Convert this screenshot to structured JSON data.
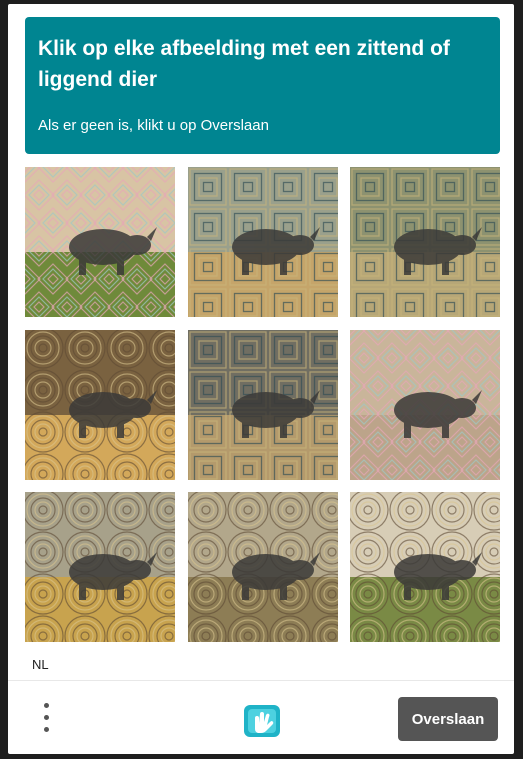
{
  "challenge": {
    "title": "Klik op elke afbeelding met een zittend of liggend dier",
    "subtitle": "Als er geen is, klikt u op Overslaan",
    "accent": "#008591"
  },
  "tiles": [
    {
      "name": "tile-1",
      "pattern": "diamond",
      "tone": "#d8c4a4",
      "ground": "#6f8a3a"
    },
    {
      "name": "tile-2",
      "pattern": "square",
      "tone": "#9aa08c",
      "ground": "#c5a56a"
    },
    {
      "name": "tile-3",
      "pattern": "square",
      "tone": "#8d9270",
      "ground": "#b7a777"
    },
    {
      "name": "tile-4",
      "pattern": "ring",
      "tone": "#7a6240",
      "ground": "#d3a85a"
    },
    {
      "name": "tile-5",
      "pattern": "square",
      "tone": "#706e62",
      "ground": "#b49a6c"
    },
    {
      "name": "tile-6",
      "pattern": "diamond",
      "tone": "#c9b59a",
      "ground": "#bca48a"
    },
    {
      "name": "tile-7",
      "pattern": "ring",
      "tone": "#a7a18a",
      "ground": "#c8a34e"
    },
    {
      "name": "tile-8",
      "pattern": "ring",
      "tone": "#b2a78b",
      "ground": "#8d7d55"
    },
    {
      "name": "tile-9",
      "pattern": "ring",
      "tone": "#d7cdb6",
      "ground": "#7a8a45"
    }
  ],
  "language": "NL",
  "footer": {
    "skip_label": "Overslaan",
    "menu_icon": "three-dots-vertical-icon",
    "logo_icon": "hand-logo-icon"
  }
}
